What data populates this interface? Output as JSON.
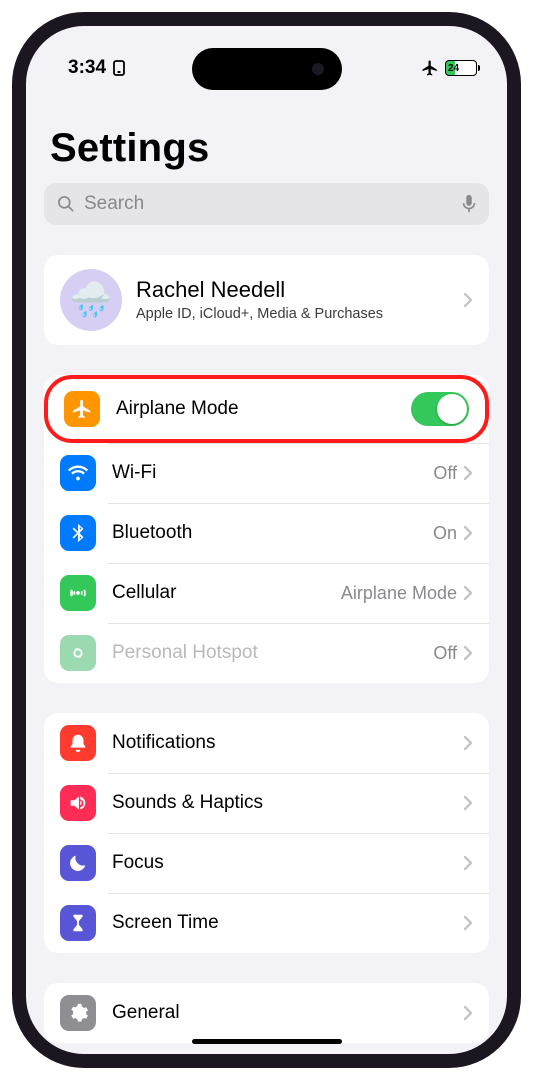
{
  "status": {
    "time": "3:34",
    "battery_pct": "24"
  },
  "page": {
    "title": "Settings"
  },
  "search": {
    "placeholder": "Search"
  },
  "profile": {
    "name": "Rachel Needell",
    "subtitle": "Apple ID, iCloud+, Media & Purchases"
  },
  "network": {
    "airplane": {
      "label": "Airplane Mode",
      "on": true
    },
    "wifi": {
      "label": "Wi-Fi",
      "value": "Off"
    },
    "bluetooth": {
      "label": "Bluetooth",
      "value": "On"
    },
    "cellular": {
      "label": "Cellular",
      "value": "Airplane Mode"
    },
    "hotspot": {
      "label": "Personal Hotspot",
      "value": "Off"
    }
  },
  "activity": {
    "notifications": {
      "label": "Notifications"
    },
    "sounds": {
      "label": "Sounds & Haptics"
    },
    "focus": {
      "label": "Focus"
    },
    "screentime": {
      "label": "Screen Time"
    }
  },
  "system": {
    "general": {
      "label": "General"
    }
  }
}
